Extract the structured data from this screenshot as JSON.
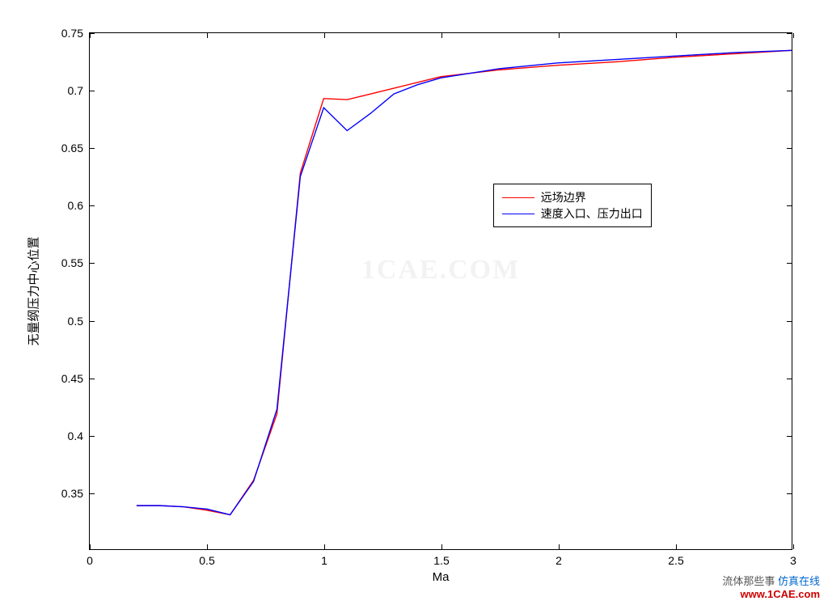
{
  "chart_data": {
    "type": "line",
    "xlabel": "Ma",
    "ylabel": "无量纲压力中心位置",
    "xlim": [
      0,
      3
    ],
    "ylim": [
      0.3,
      0.75
    ],
    "xticks": [
      0,
      0.5,
      1,
      1.5,
      2,
      2.5,
      3
    ],
    "yticks": [
      0.35,
      0.4,
      0.45,
      0.5,
      0.55,
      0.6,
      0.65,
      0.7,
      0.75
    ],
    "series": [
      {
        "name": "远场边界",
        "color": "#ff0000",
        "x": [
          0.2,
          0.3,
          0.4,
          0.5,
          0.6,
          0.7,
          0.8,
          0.9,
          1.0,
          1.1,
          1.2,
          1.3,
          1.4,
          1.5,
          1.75,
          2.0,
          2.25,
          2.5,
          2.75,
          3.0
        ],
        "y": [
          0.338,
          0.338,
          0.337,
          0.334,
          0.33,
          0.36,
          0.418,
          0.628,
          0.693,
          0.692,
          0.697,
          0.702,
          0.707,
          0.712,
          0.718,
          0.722,
          0.725,
          0.729,
          0.732,
          0.735
        ]
      },
      {
        "name": "速度入口、压力出口",
        "color": "#0000ff",
        "x": [
          0.2,
          0.3,
          0.4,
          0.5,
          0.6,
          0.7,
          0.8,
          0.9,
          1.0,
          1.1,
          1.2,
          1.3,
          1.4,
          1.5,
          1.75,
          2.0,
          2.25,
          2.5,
          2.75,
          3.0
        ],
        "y": [
          0.338,
          0.338,
          0.337,
          0.335,
          0.33,
          0.359,
          0.422,
          0.625,
          0.685,
          0.665,
          0.68,
          0.697,
          0.705,
          0.711,
          0.719,
          0.724,
          0.727,
          0.73,
          0.733,
          0.735
        ]
      }
    ]
  },
  "legend": {
    "items": [
      {
        "label": "远场边界",
        "color": "#ff0000"
      },
      {
        "label": "速度入口、压力出口",
        "color": "#0000ff"
      }
    ]
  },
  "watermark": "1CAE.COM",
  "footer": {
    "line1": "流体那些事",
    "line2": "www.1CAE.com",
    "overlay": "仿真在线"
  }
}
